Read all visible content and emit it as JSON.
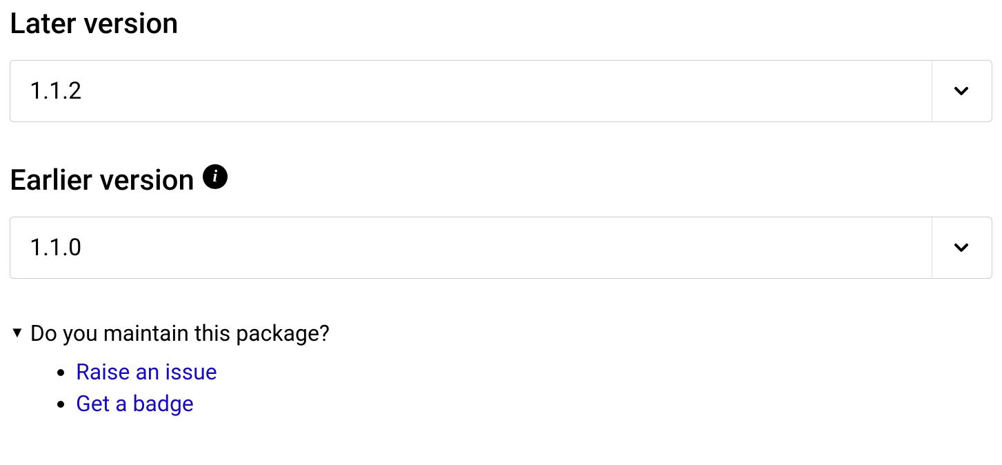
{
  "later_version": {
    "heading": "Later version",
    "selected": "1.1.2"
  },
  "earlier_version": {
    "heading": "Earlier version",
    "selected": "1.1.0"
  },
  "maintainer": {
    "summary": "Do you maintain this package?",
    "links": {
      "raise_issue": "Raise an issue",
      "get_badge": "Get a badge"
    }
  }
}
